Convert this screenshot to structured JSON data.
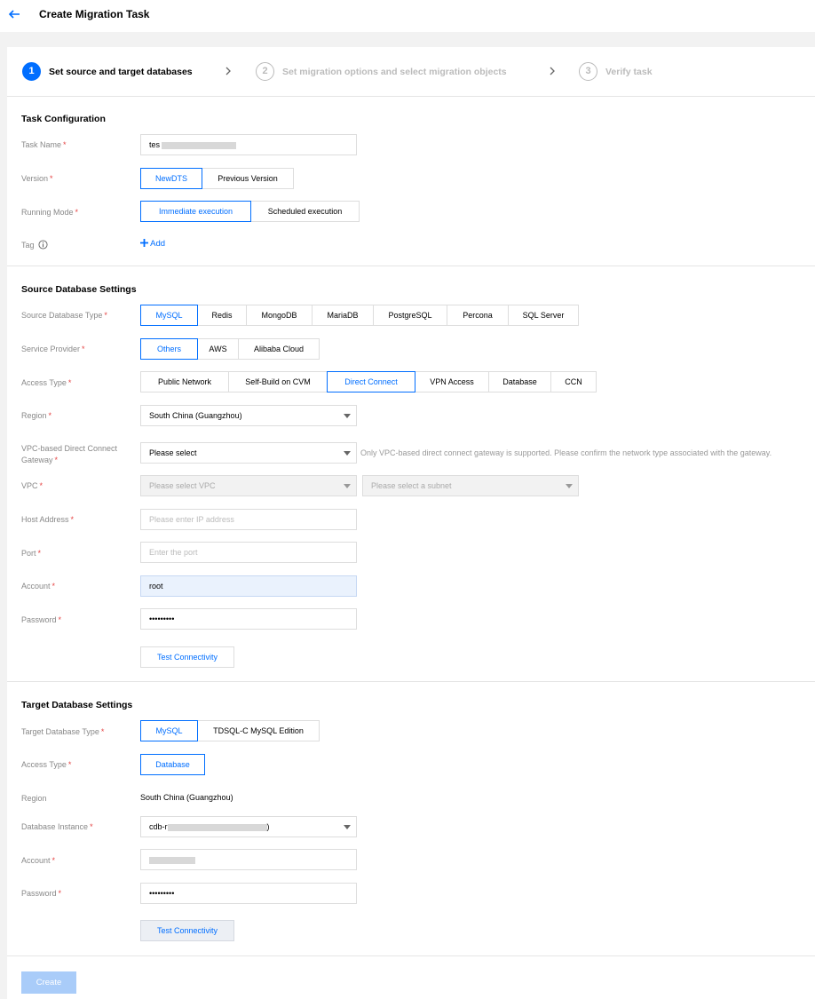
{
  "header": {
    "title": "Create Migration Task"
  },
  "steps": [
    {
      "number": "1",
      "label": "Set source and target databases"
    },
    {
      "number": "2",
      "label": "Set migration options and select migration objects"
    },
    {
      "number": "3",
      "label": "Verify task"
    }
  ],
  "task_config": {
    "title": "Task Configuration",
    "task_name": {
      "label": "Task Name",
      "value": "tes"
    },
    "version": {
      "label": "Version",
      "options": [
        "NewDTS",
        "Previous Version"
      ],
      "selected": "NewDTS"
    },
    "running_mode": {
      "label": "Running Mode",
      "options": [
        "Immediate execution",
        "Scheduled execution"
      ],
      "selected": "Immediate execution"
    },
    "tag": {
      "label": "Tag",
      "add_label": "Add"
    }
  },
  "source": {
    "title": "Source Database Settings",
    "db_type": {
      "label": "Source Database Type",
      "options": [
        "MySQL",
        "Redis",
        "MongoDB",
        "MariaDB",
        "PostgreSQL",
        "Percona",
        "SQL Server"
      ],
      "selected": "MySQL"
    },
    "provider": {
      "label": "Service Provider",
      "options": [
        "Others",
        "AWS",
        "Alibaba Cloud"
      ],
      "selected": "Others"
    },
    "access_type": {
      "label": "Access Type",
      "options": [
        "Public Network",
        "Self-Build on CVM",
        "Direct Connect",
        "VPN Access",
        "Database",
        "CCN"
      ],
      "selected": "Direct Connect"
    },
    "region": {
      "label": "Region",
      "value": "South China (Guangzhou)"
    },
    "gateway": {
      "label_line1": "VPC-based Direct Connect",
      "label_line2": "Gateway",
      "value": "Please select",
      "hint": "Only VPC-based direct connect gateway is supported. Please confirm the network type associated with the gateway."
    },
    "vpc": {
      "label": "VPC",
      "vpc_placeholder": "Please select VPC",
      "subnet_placeholder": "Please select a subnet"
    },
    "host": {
      "label": "Host Address",
      "placeholder": "Please enter IP address"
    },
    "port": {
      "label": "Port",
      "placeholder": "Enter the port"
    },
    "account": {
      "label": "Account",
      "value": "root"
    },
    "password": {
      "label": "Password",
      "value": "•••••••••"
    },
    "test_button": "Test Connectivity"
  },
  "target": {
    "title": "Target Database Settings",
    "db_type": {
      "label": "Target Database Type",
      "options": [
        "MySQL",
        "TDSQL-C MySQL Edition"
      ],
      "selected": "MySQL"
    },
    "access_type": {
      "label": "Access Type",
      "value": "Database"
    },
    "region": {
      "label": "Region",
      "value": "South China (Guangzhou)"
    },
    "instance": {
      "label": "Database Instance",
      "value_prefix": "cdb-r",
      "value_suffix": ")"
    },
    "account": {
      "label": "Account"
    },
    "password": {
      "label": "Password",
      "value": "•••••••••"
    },
    "test_button": "Test Connectivity"
  },
  "footer": {
    "create_label": "Create"
  },
  "colors": {
    "accent": "#006eff",
    "required": "#e54545",
    "muted_label": "#888888"
  }
}
